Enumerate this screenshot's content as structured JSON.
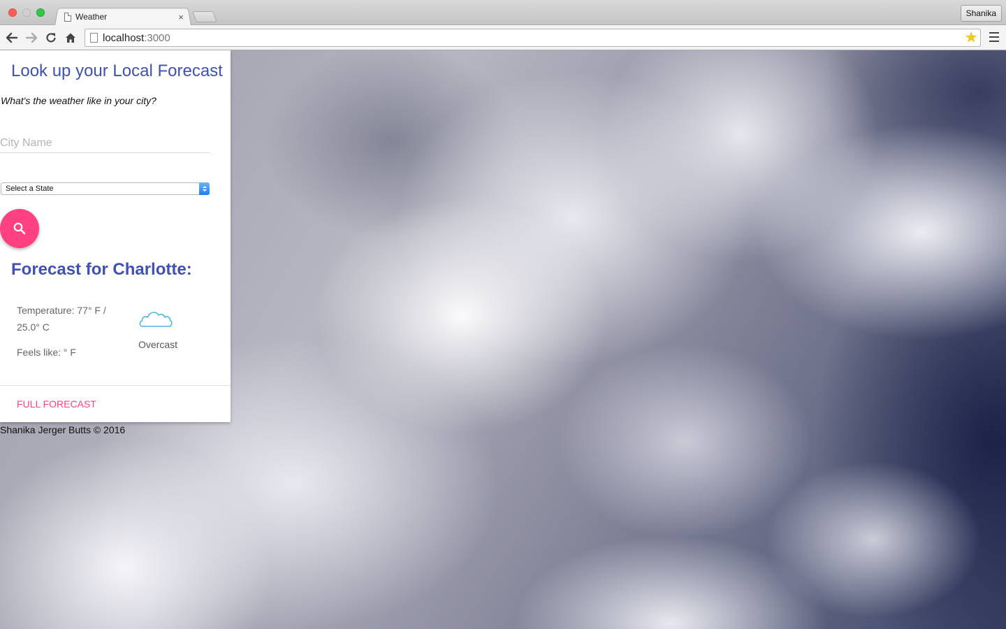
{
  "browser": {
    "tab_title": "Weather",
    "tab_close": "×",
    "profile_name": "Shanika",
    "url_host": "localhost",
    "url_port": ":3000",
    "star_icon": "star-icon"
  },
  "page": {
    "heading": "Look up your Local Forecast",
    "subtitle": "What's the weather like in your city?",
    "city_placeholder": "City Name",
    "state_select_value": "Select a State",
    "search_button_icon": "search-icon",
    "forecast_heading": "Forecast for Charlotte:",
    "temperature": "Temperature: 77° F / 25.0° C",
    "feels_like": "Feels like: ° F",
    "condition": "Overcast",
    "condition_icon": "cloud-icon",
    "full_forecast_link": "Full Forecast",
    "footer": "Shanika Jerger Butts © 2016"
  },
  "colors": {
    "primary": "#3f51b5",
    "accent": "#ff4081",
    "cloud_icon": "#4fb4e6"
  }
}
